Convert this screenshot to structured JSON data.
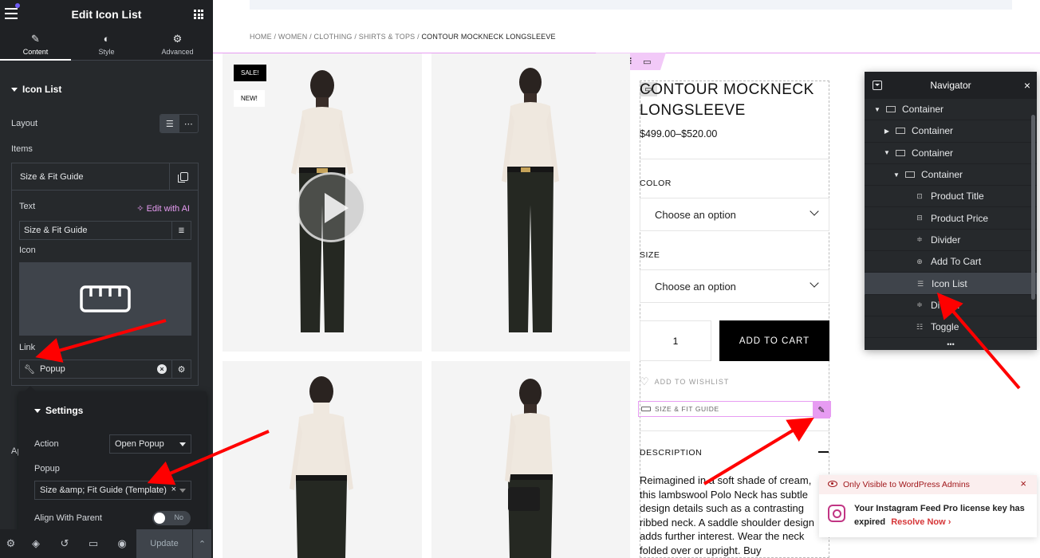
{
  "panel": {
    "header_title": "Edit Icon List",
    "tabs": [
      {
        "label": "Content",
        "icon": "pencil-icon"
      },
      {
        "label": "Style",
        "icon": "half-circle-icon"
      },
      {
        "label": "Advanced",
        "icon": "gear-icon"
      }
    ],
    "section_title": "Icon List",
    "layout_label": "Layout",
    "items_label": "Items",
    "item_title": "Size & Fit Guide",
    "text_label": "Text",
    "edit_with_ai": "Edit with AI",
    "text_value": "Size & Fit Guide",
    "icon_label": "Icon",
    "link_label": "Link",
    "link_value": "Popup",
    "truncated_label": "Ap",
    "settings": {
      "title": "Settings",
      "action_label": "Action",
      "action_value": "Open Popup",
      "popup_label": "Popup",
      "popup_value": "Size &amp; Fit Guide (Template)",
      "align_label": "Align With Parent",
      "align_toggle": "No"
    },
    "footer": {
      "update_label": "Update"
    }
  },
  "canvas": {
    "breadcrumb": {
      "items": [
        "HOME",
        "WOMEN",
        "CLOTHING",
        "SHIRTS & TOPS"
      ],
      "current": "CONTOUR MOCKNECK LONGSLEEVE",
      "separator": " / "
    },
    "badges": {
      "sale": "SALE!",
      "new": "NEW!"
    },
    "product": {
      "title": "CONTOUR MOCKNECK LONGSLEEVE",
      "price": "$499.00–$520.00",
      "color_label": "COLOR",
      "color_placeholder": "Choose an option",
      "size_label": "SIZE",
      "size_placeholder": "Choose an option",
      "quantity": "1",
      "add_to_cart": "ADD TO CART",
      "wishlist": "ADD TO WISHLIST",
      "size_fit": "SIZE & FIT GUIDE",
      "description_title": "DESCRIPTION",
      "description_text": "Reimagined in a soft shade of cream, this lambswool Polo Neck has subtle design details such as a contrasting ribbed neck. A saddle shoulder design adds further interest. Wear the neck folded over or upright. Buy"
    }
  },
  "navigator": {
    "title": "Navigator",
    "items": [
      {
        "label": "Container",
        "depth": 0,
        "arrow": "down",
        "icon": "container-icon"
      },
      {
        "label": "Container",
        "depth": 1,
        "arrow": "right",
        "icon": "container-icon"
      },
      {
        "label": "Container",
        "depth": 1,
        "arrow": "down",
        "icon": "container-icon"
      },
      {
        "label": "Container",
        "depth": 2,
        "arrow": "down",
        "icon": "container-icon"
      },
      {
        "label": "Product Title",
        "depth": 3,
        "arrow": "",
        "icon": "product-title-icon"
      },
      {
        "label": "Product Price",
        "depth": 3,
        "arrow": "",
        "icon": "product-price-icon"
      },
      {
        "label": "Divider",
        "depth": 3,
        "arrow": "",
        "icon": "divider-icon"
      },
      {
        "label": "Add To Cart",
        "depth": 3,
        "arrow": "",
        "icon": "add-to-cart-icon"
      },
      {
        "label": "Icon List",
        "depth": 3,
        "arrow": "",
        "icon": "icon-list-icon",
        "selected": true
      },
      {
        "label": "Divider",
        "depth": 3,
        "arrow": "",
        "icon": "divider-icon"
      },
      {
        "label": "Toggle",
        "depth": 3,
        "arrow": "",
        "icon": "toggle-icon"
      }
    ]
  },
  "notice": {
    "header": "Only Visible to WordPress Admins",
    "message": "Your Instagram Feed Pro license key has expired",
    "action": "Resolve Now"
  },
  "colors": {
    "panel_bg": "#26292c",
    "accent_pink": "#e79cf2",
    "annotation_red": "#ff0000",
    "notice_red": "#a0171b"
  }
}
